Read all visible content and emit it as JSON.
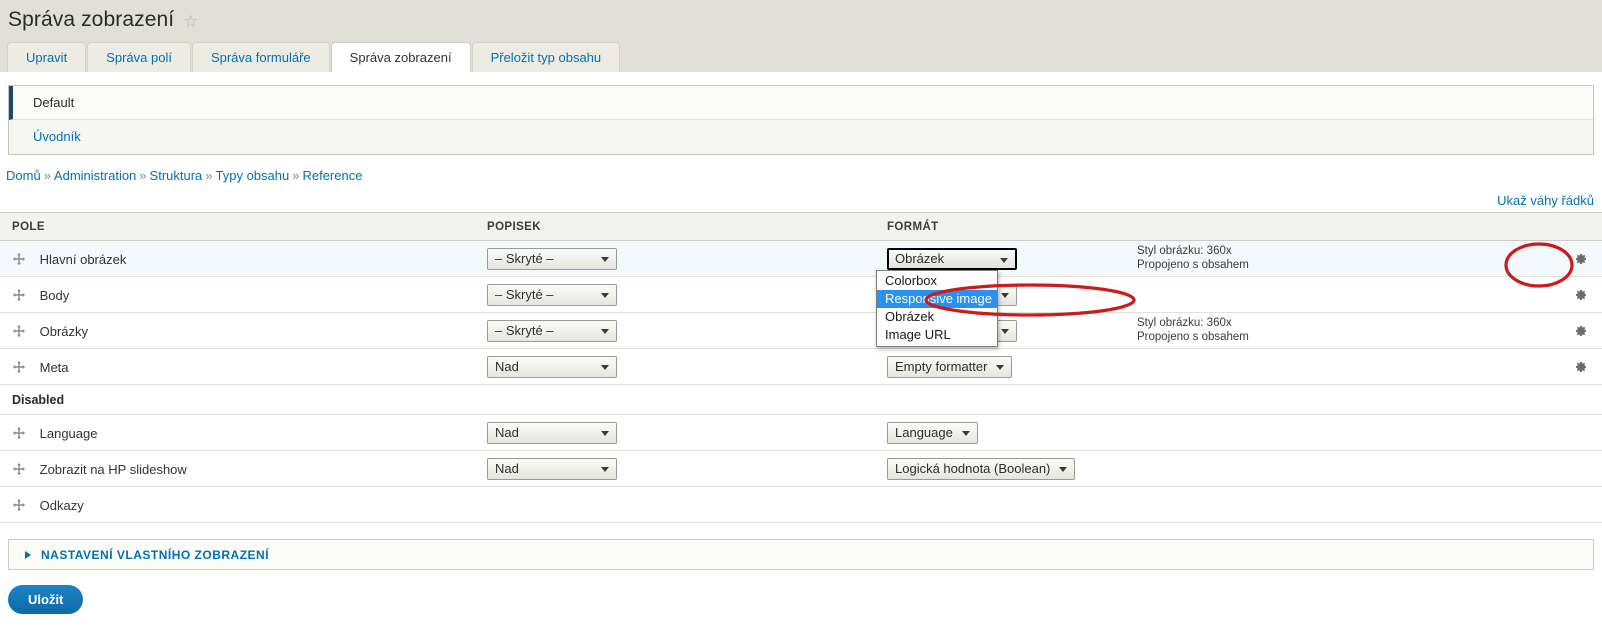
{
  "header": {
    "title": "Správa zobrazení",
    "star_icon": "star-outline-icon"
  },
  "tabs": [
    {
      "label": "Upravit",
      "active": false
    },
    {
      "label": "Správa polí",
      "active": false
    },
    {
      "label": "Správa formuláře",
      "active": false
    },
    {
      "label": "Správa zobrazení",
      "active": true
    },
    {
      "label": "Přeložit typ obsahu",
      "active": false
    }
  ],
  "view_modes": [
    {
      "label": "Default",
      "active": true
    },
    {
      "label": "Úvodník",
      "active": false
    }
  ],
  "breadcrumb": {
    "items": [
      "Domů",
      "Administration",
      "Struktura",
      "Typy obsahu",
      "Reference"
    ],
    "separator": "»"
  },
  "weights_link": "Ukaž váhy řádků",
  "table": {
    "columns": [
      "POLE",
      "POPISEK",
      "FORMÁT",
      "",
      ""
    ],
    "rows": [
      {
        "field": "Hlavní obrázek",
        "label_select": "– Skryté –",
        "format_select": "Obrázek",
        "summary": "Styl obrázku: 360x\nPropojeno s obsahem",
        "summary_line1": "Styl obrázku: 360x",
        "summary_line2": "Propojeno s obsahem",
        "has_gear": true,
        "highlighted": true,
        "format_focused": true
      },
      {
        "field": "Body",
        "label_select": "– Skryté –",
        "format_select": "",
        "summary_line1": "",
        "summary_line2": "",
        "has_gear": true,
        "highlighted": false,
        "format_focused": false
      },
      {
        "field": "Obrázky",
        "label_select": "– Skryté –",
        "format_select": "",
        "summary_line1": "Styl obrázku: 360x",
        "summary_line2": "Propojeno s obsahem",
        "has_gear": true,
        "highlighted": false,
        "format_focused": false
      },
      {
        "field": "Meta",
        "label_select": "Nad",
        "format_select": "Empty formatter",
        "summary_line1": "",
        "summary_line2": "",
        "has_gear": true,
        "highlighted": false,
        "format_focused": false
      }
    ],
    "disabled_region": "Disabled",
    "disabled_rows": [
      {
        "field": "Language",
        "label_select": "Nad",
        "format_select": "Language",
        "summary_line1": "",
        "summary_line2": "",
        "has_gear": false
      },
      {
        "field": "Zobrazit na HP slideshow",
        "label_select": "Nad",
        "format_select": "Logická hodnota (Boolean)",
        "summary_line1": "",
        "summary_line2": "",
        "has_gear": false
      },
      {
        "field": "Odkazy",
        "label_select": "",
        "format_select": "",
        "summary_line1": "",
        "summary_line2": "",
        "has_gear": false
      }
    ]
  },
  "open_dropdown": {
    "options": [
      "Colorbox",
      "Responsive image",
      "Obrázek",
      "Image URL"
    ],
    "selected": "Responsive image",
    "selected_index": 1
  },
  "custom_display_fieldset": {
    "legend": "Nastavení vlastního zobrazení",
    "triangle_icon": "triangle-right-icon"
  },
  "save_button": "Uložit",
  "colors": {
    "page_background": "#e0e0d8",
    "content_background": "#ffffff",
    "link": "#0071b3",
    "accent_button": "#1a84c7",
    "dropdown_highlight": "#2b91f0",
    "annotation_red": "#cc1b1b",
    "row_highlight": "#f3f9fc",
    "active_vtab_border": "#1b4b66"
  },
  "annotations": [
    {
      "name": "gear-ellipse",
      "shape": "ellipse"
    },
    {
      "name": "dropdown-option-ellipse",
      "shape": "ellipse"
    }
  ]
}
